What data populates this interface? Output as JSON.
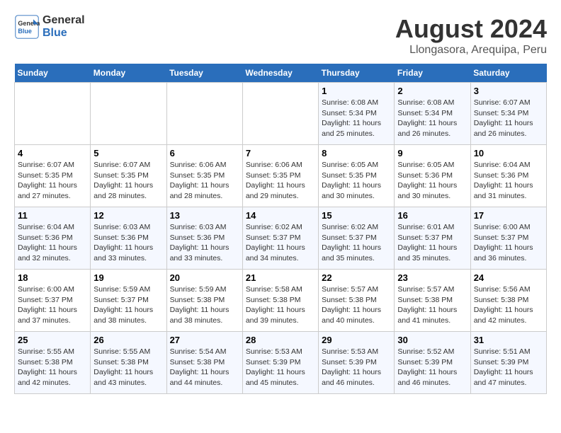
{
  "header": {
    "logo_line1": "General",
    "logo_line2": "Blue",
    "title": "August 2024",
    "subtitle": "Llongasora, Arequipa, Peru"
  },
  "days_of_week": [
    "Sunday",
    "Monday",
    "Tuesday",
    "Wednesday",
    "Thursday",
    "Friday",
    "Saturday"
  ],
  "weeks": [
    [
      {
        "day": "",
        "content": ""
      },
      {
        "day": "",
        "content": ""
      },
      {
        "day": "",
        "content": ""
      },
      {
        "day": "",
        "content": ""
      },
      {
        "day": "1",
        "content": "Sunrise: 6:08 AM\nSunset: 5:34 PM\nDaylight: 11 hours\nand 25 minutes."
      },
      {
        "day": "2",
        "content": "Sunrise: 6:08 AM\nSunset: 5:34 PM\nDaylight: 11 hours\nand 26 minutes."
      },
      {
        "day": "3",
        "content": "Sunrise: 6:07 AM\nSunset: 5:34 PM\nDaylight: 11 hours\nand 26 minutes."
      }
    ],
    [
      {
        "day": "4",
        "content": "Sunrise: 6:07 AM\nSunset: 5:35 PM\nDaylight: 11 hours\nand 27 minutes."
      },
      {
        "day": "5",
        "content": "Sunrise: 6:07 AM\nSunset: 5:35 PM\nDaylight: 11 hours\nand 28 minutes."
      },
      {
        "day": "6",
        "content": "Sunrise: 6:06 AM\nSunset: 5:35 PM\nDaylight: 11 hours\nand 28 minutes."
      },
      {
        "day": "7",
        "content": "Sunrise: 6:06 AM\nSunset: 5:35 PM\nDaylight: 11 hours\nand 29 minutes."
      },
      {
        "day": "8",
        "content": "Sunrise: 6:05 AM\nSunset: 5:35 PM\nDaylight: 11 hours\nand 30 minutes."
      },
      {
        "day": "9",
        "content": "Sunrise: 6:05 AM\nSunset: 5:36 PM\nDaylight: 11 hours\nand 30 minutes."
      },
      {
        "day": "10",
        "content": "Sunrise: 6:04 AM\nSunset: 5:36 PM\nDaylight: 11 hours\nand 31 minutes."
      }
    ],
    [
      {
        "day": "11",
        "content": "Sunrise: 6:04 AM\nSunset: 5:36 PM\nDaylight: 11 hours\nand 32 minutes."
      },
      {
        "day": "12",
        "content": "Sunrise: 6:03 AM\nSunset: 5:36 PM\nDaylight: 11 hours\nand 33 minutes."
      },
      {
        "day": "13",
        "content": "Sunrise: 6:03 AM\nSunset: 5:36 PM\nDaylight: 11 hours\nand 33 minutes."
      },
      {
        "day": "14",
        "content": "Sunrise: 6:02 AM\nSunset: 5:37 PM\nDaylight: 11 hours\nand 34 minutes."
      },
      {
        "day": "15",
        "content": "Sunrise: 6:02 AM\nSunset: 5:37 PM\nDaylight: 11 hours\nand 35 minutes."
      },
      {
        "day": "16",
        "content": "Sunrise: 6:01 AM\nSunset: 5:37 PM\nDaylight: 11 hours\nand 35 minutes."
      },
      {
        "day": "17",
        "content": "Sunrise: 6:00 AM\nSunset: 5:37 PM\nDaylight: 11 hours\nand 36 minutes."
      }
    ],
    [
      {
        "day": "18",
        "content": "Sunrise: 6:00 AM\nSunset: 5:37 PM\nDaylight: 11 hours\nand 37 minutes."
      },
      {
        "day": "19",
        "content": "Sunrise: 5:59 AM\nSunset: 5:37 PM\nDaylight: 11 hours\nand 38 minutes."
      },
      {
        "day": "20",
        "content": "Sunrise: 5:59 AM\nSunset: 5:38 PM\nDaylight: 11 hours\nand 38 minutes."
      },
      {
        "day": "21",
        "content": "Sunrise: 5:58 AM\nSunset: 5:38 PM\nDaylight: 11 hours\nand 39 minutes."
      },
      {
        "day": "22",
        "content": "Sunrise: 5:57 AM\nSunset: 5:38 PM\nDaylight: 11 hours\nand 40 minutes."
      },
      {
        "day": "23",
        "content": "Sunrise: 5:57 AM\nSunset: 5:38 PM\nDaylight: 11 hours\nand 41 minutes."
      },
      {
        "day": "24",
        "content": "Sunrise: 5:56 AM\nSunset: 5:38 PM\nDaylight: 11 hours\nand 42 minutes."
      }
    ],
    [
      {
        "day": "25",
        "content": "Sunrise: 5:55 AM\nSunset: 5:38 PM\nDaylight: 11 hours\nand 42 minutes."
      },
      {
        "day": "26",
        "content": "Sunrise: 5:55 AM\nSunset: 5:38 PM\nDaylight: 11 hours\nand 43 minutes."
      },
      {
        "day": "27",
        "content": "Sunrise: 5:54 AM\nSunset: 5:38 PM\nDaylight: 11 hours\nand 44 minutes."
      },
      {
        "day": "28",
        "content": "Sunrise: 5:53 AM\nSunset: 5:39 PM\nDaylight: 11 hours\nand 45 minutes."
      },
      {
        "day": "29",
        "content": "Sunrise: 5:53 AM\nSunset: 5:39 PM\nDaylight: 11 hours\nand 46 minutes."
      },
      {
        "day": "30",
        "content": "Sunrise: 5:52 AM\nSunset: 5:39 PM\nDaylight: 11 hours\nand 46 minutes."
      },
      {
        "day": "31",
        "content": "Sunrise: 5:51 AM\nSunset: 5:39 PM\nDaylight: 11 hours\nand 47 minutes."
      }
    ]
  ]
}
